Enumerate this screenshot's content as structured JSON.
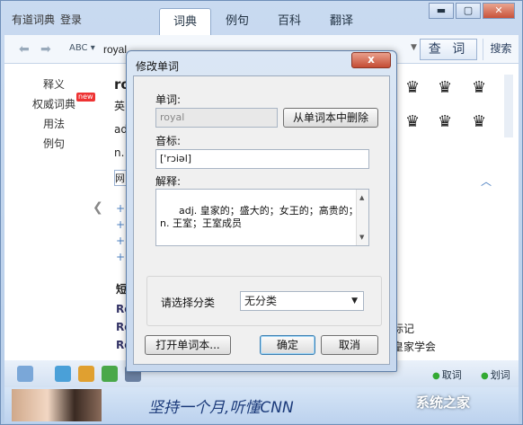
{
  "app": {
    "title": "有道词典",
    "login": "登录",
    "tabs": [
      "词典",
      "例句",
      "百科",
      "翻译"
    ],
    "active_tab": 0
  },
  "toolbar": {
    "search_value": "royal",
    "abc_label": "ABC",
    "search_button": "查 词",
    "search_button2": "搜索"
  },
  "leftnav": {
    "items": [
      "释义",
      "权威词典",
      "用法",
      "例句"
    ],
    "new_badge": "new"
  },
  "background": {
    "word": "roy",
    "line1": "英",
    "line2": "ad",
    "line3": "n.",
    "box": "网",
    "heading": "短",
    "rows": [
      "Ro",
      "Ro",
      "Ro"
    ],
    "row_right1": "标记",
    "row_right2": "皇家学会"
  },
  "bottombar": {
    "quci": "取词",
    "huaci": "划词"
  },
  "ad": {
    "text": "坚持一个月,听懂CNN",
    "watermark": "系统之家"
  },
  "dialog": {
    "title": "修改单词",
    "close_label": "x",
    "word_label": "单词:",
    "word_value": "royal",
    "delete_button": "从单词本中删除",
    "phonetic_label": "音标:",
    "phonetic_value": "['rɔiəl]",
    "definition_label": "解释:",
    "definition_value": "adj. 皇家的；盛大的；女王的；高贵的；\nn. 王室；王室成员",
    "category_label": "请选择分类",
    "category_value": "无分类",
    "open_button": "打开单词本...",
    "ok_button": "确定",
    "cancel_button": "取消"
  }
}
